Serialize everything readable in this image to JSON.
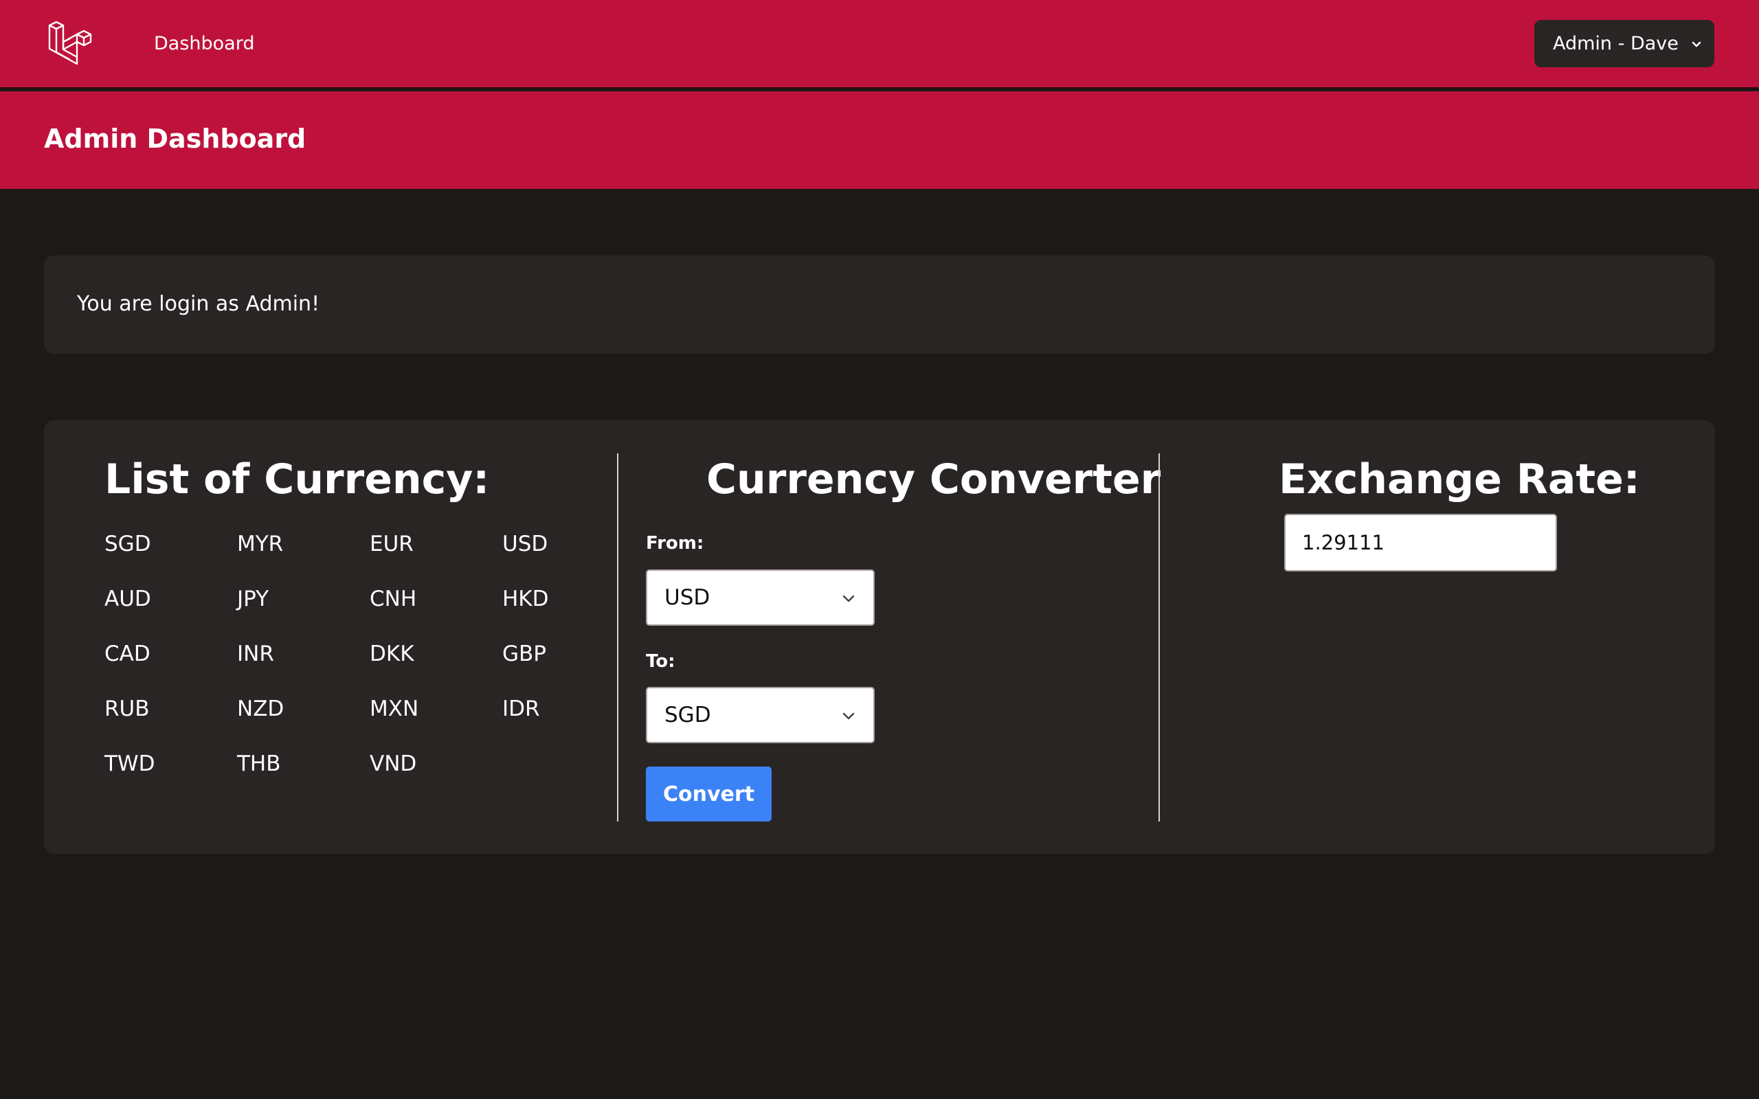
{
  "nav": {
    "logo_icon": "laravel-logo-icon",
    "dashboard_link": "Dashboard",
    "user_menu_label": "Admin - Dave",
    "user_menu_icon": "chevron-down-icon"
  },
  "header": {
    "title": "Admin Dashboard"
  },
  "notice": {
    "text": "You are login as Admin!"
  },
  "currency_list": {
    "title": "List of Currency:",
    "codes": [
      "SGD",
      "MYR",
      "EUR",
      "USD",
      "AUD",
      "JPY",
      "CNH",
      "HKD",
      "CAD",
      "INR",
      "DKK",
      "GBP",
      "RUB",
      "NZD",
      "MXN",
      "IDR",
      "TWD",
      "THB",
      "VND"
    ]
  },
  "converter": {
    "title": "Currency Converter",
    "from_label": "From:",
    "from_value": "USD",
    "to_label": "To:",
    "to_value": "SGD",
    "convert_button": "Convert"
  },
  "exchange": {
    "title": "Exchange Rate:",
    "value": "1.29111"
  },
  "colors": {
    "brand": "#be123c",
    "background": "#1c1917",
    "card": "#292524",
    "button": "#3b82f6"
  }
}
